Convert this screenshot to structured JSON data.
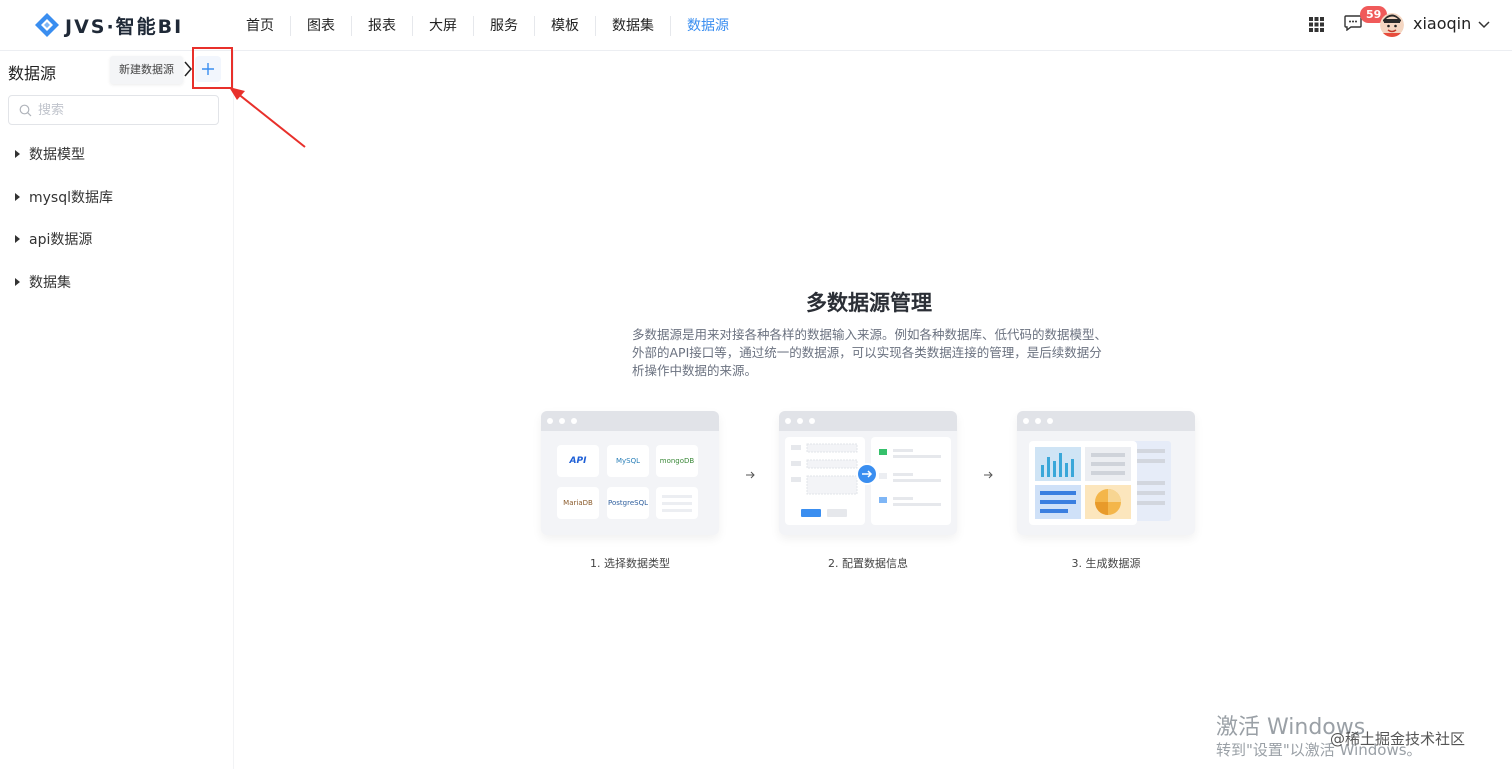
{
  "app": {
    "logo_text": "JVS·智能BI"
  },
  "nav": {
    "items": [
      "首页",
      "图表",
      "报表",
      "大屏",
      "服务",
      "模板",
      "数据集",
      "数据源"
    ],
    "active_index": 7
  },
  "header": {
    "badge_count": "59",
    "username": "xiaoqin"
  },
  "sidebar": {
    "title": "数据源",
    "tooltip": "新建数据源",
    "search_placeholder": "搜索",
    "tree": [
      "数据模型",
      "mysql数据库",
      "api数据源",
      "数据集"
    ]
  },
  "main": {
    "title": "多数据源管理",
    "description": "多数据源是用来对接各种各样的数据输入来源。例如各种数据库、低代码的数据模型、外部的API接口等，通过统一的数据源，可以实现各类数据连接的管理，是后续数据分析操作中数据的来源。",
    "steps": [
      {
        "label": "1. 选择数据类型"
      },
      {
        "label": "2. 配置数据信息"
      },
      {
        "label": "3. 生成数据源"
      }
    ],
    "tiles": {
      "api": "API",
      "mysql": "MySQL",
      "mongodb": "mongoDB",
      "mariadb": "MariaDB",
      "postgresql": "PostgreSQL"
    }
  },
  "overlay": {
    "watermark_title": "激活 Windows",
    "watermark_sub": "转到\"设置\"以激活 Windows。",
    "juejin": "@稀土掘金技术社区"
  },
  "colors": {
    "accent": "#3a8ef0",
    "badge": "#f05a5a",
    "highlight": "#e8302b"
  }
}
